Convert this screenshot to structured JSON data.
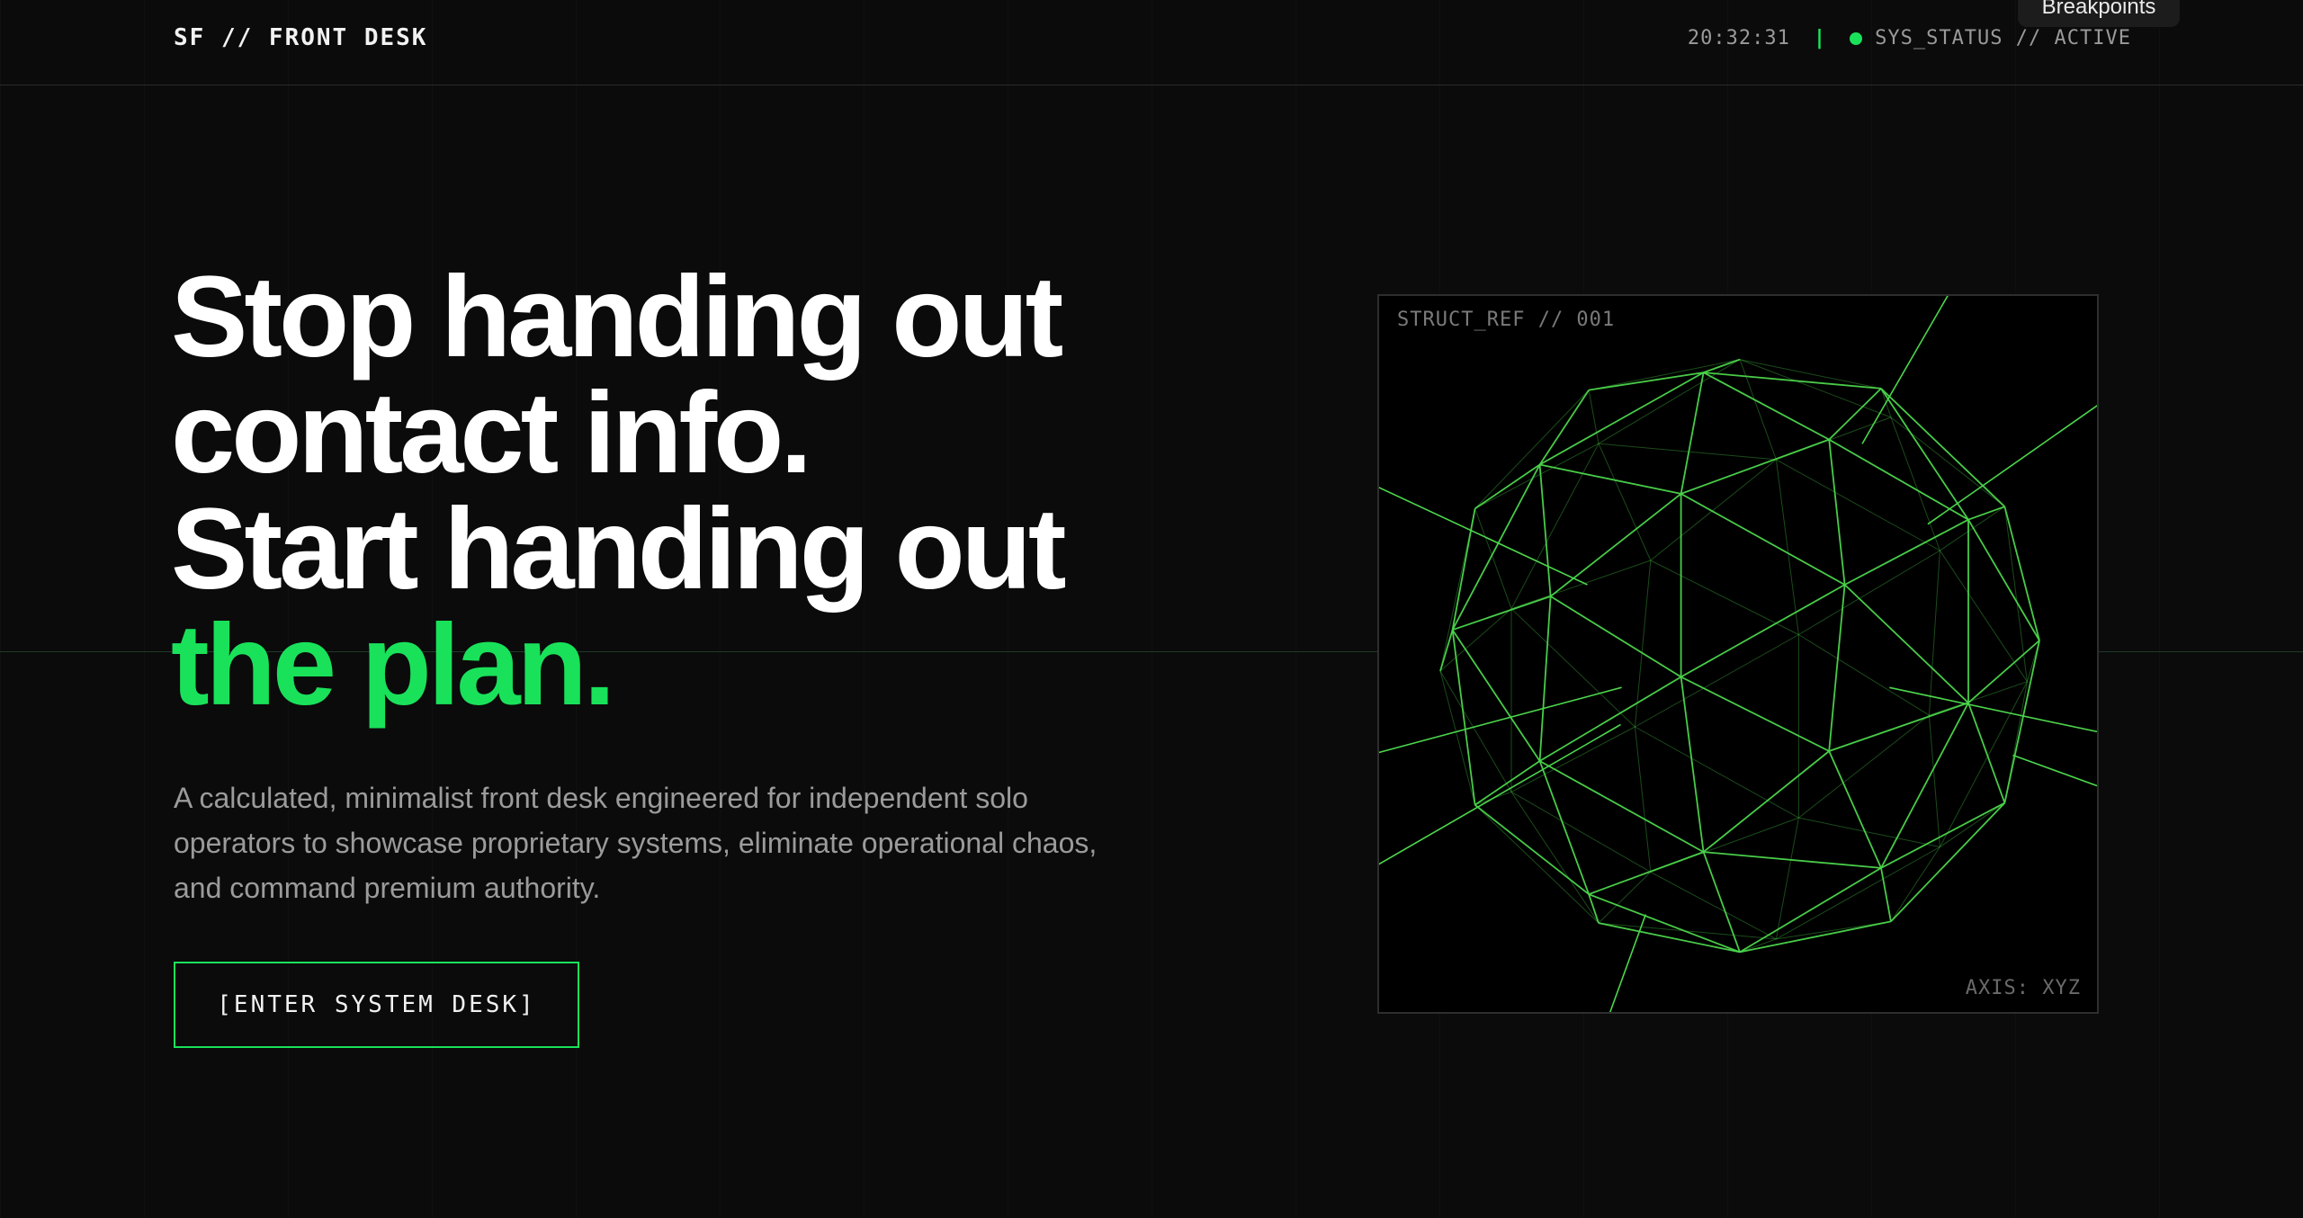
{
  "header": {
    "brand": "SF // FRONT DESK",
    "time": "20:32:31",
    "separator": "|",
    "status": "SYS_STATUS // ACTIVE"
  },
  "tooltip": {
    "label": "Breakpoints"
  },
  "hero": {
    "line1": "Stop handing out",
    "line2": "contact info.",
    "line3": "Start handing out",
    "line4_accent": "the plan.",
    "subtext": "A calculated, minimalist front desk engineered for independent solo operators to showcase proprietary systems, eliminate operational chaos, and command premium authority.",
    "cta_label": "[ENTER SYSTEM DESK]"
  },
  "visual": {
    "ref_label": "STRUCT_REF // 001",
    "axis_label": "AXIS: XYZ",
    "icon": "wireframe-geodesic-sphere"
  },
  "colors": {
    "accent": "#19e25a",
    "background": "#0b0b0b",
    "panel": "#000000",
    "wireframe": "#4cd64c"
  }
}
